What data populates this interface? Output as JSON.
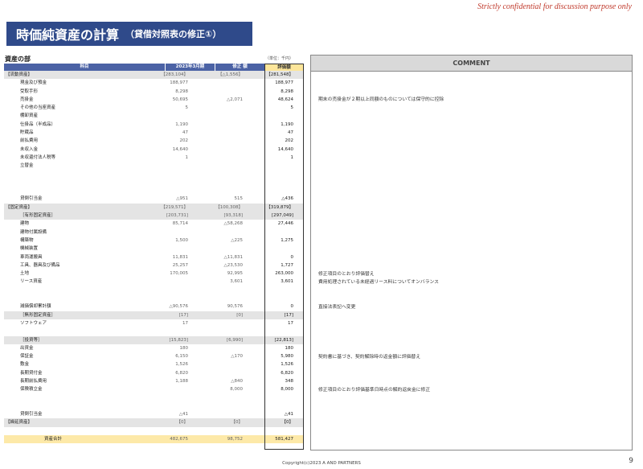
{
  "confidential": "Strictly confidential for discussion purpose only",
  "title": "時価純資産の計算",
  "subtitle": "（貸借対照表の修正①）",
  "section": "資産の部",
  "unit": "（単位：千円）",
  "headers": {
    "item": "科目",
    "col1": "2023年3月期",
    "col2": "修正 額",
    "col3": "評価額"
  },
  "rows": [
    {
      "label": "【流動資産】",
      "indent": 0,
      "shade": true,
      "v1": "【283,104】",
      "v2": "【△1,556】",
      "v3": "【281,548】"
    },
    {
      "label": "現金及び預金",
      "indent": 1,
      "v1": "188,977",
      "v2": "",
      "v3": "188,977"
    },
    {
      "label": "受取手形",
      "indent": 1,
      "v1": "8,298",
      "v2": "",
      "v3": "8,298"
    },
    {
      "label": "売掛金",
      "indent": 1,
      "v1": "50,695",
      "v2": "△2,071",
      "v3": "48,624"
    },
    {
      "label": "その他の当座資産",
      "indent": 1,
      "v1": "5",
      "v2": "",
      "v3": "5"
    },
    {
      "label": "棚卸資産",
      "indent": 1,
      "v1": "",
      "v2": "",
      "v3": ""
    },
    {
      "label": "仕掛品（半成品）",
      "indent": 1,
      "v1": "1,190",
      "v2": "",
      "v3": "1,190"
    },
    {
      "label": "貯蔵品",
      "indent": 1,
      "v1": "47",
      "v2": "",
      "v3": "47"
    },
    {
      "label": "前払費用",
      "indent": 1,
      "v1": "202",
      "v2": "",
      "v3": "202"
    },
    {
      "label": "未収入金",
      "indent": 1,
      "v1": "14,640",
      "v2": "",
      "v3": "14,640"
    },
    {
      "label": "未収還付法人税等",
      "indent": 1,
      "v1": "1",
      "v2": "",
      "v3": "1"
    },
    {
      "label": "立替金",
      "indent": 1,
      "v1": "",
      "v2": "",
      "v3": ""
    },
    {
      "label": "",
      "indent": 1,
      "v1": "",
      "v2": "",
      "v3": ""
    },
    {
      "label": "",
      "indent": 1,
      "v1": "",
      "v2": "",
      "v3": ""
    },
    {
      "label": "",
      "indent": 1,
      "v1": "",
      "v2": "",
      "v3": ""
    },
    {
      "label": "貸倒引当金",
      "indent": 1,
      "v1": "△951",
      "v2": "515",
      "v3": "△436"
    },
    {
      "label": "【固定資産】",
      "indent": 0,
      "shade": true,
      "v1": "【219,571】",
      "v2": "【100,308】",
      "v3": "【319,879】"
    },
    {
      "label": "［有形固定資産］",
      "indent": 1,
      "shade": true,
      "v1": "[203,731]",
      "v2": "[93,318]",
      "v3": "[297,049]"
    },
    {
      "label": "建物",
      "indent": 1,
      "v1": "85,714",
      "v2": "△58,268",
      "v3": "27,446"
    },
    {
      "label": "建物付属設備",
      "indent": 1,
      "v1": "",
      "v2": "",
      "v3": ""
    },
    {
      "label": "構築物",
      "indent": 1,
      "v1": "1,500",
      "v2": "△225",
      "v3": "1,275"
    },
    {
      "label": "機械装置",
      "indent": 1,
      "v1": "",
      "v2": "",
      "v3": ""
    },
    {
      "label": "車両運搬具",
      "indent": 1,
      "v1": "11,831",
      "v2": "△11,831",
      "v3": "0"
    },
    {
      "label": "工具、器具及び備品",
      "indent": 1,
      "v1": "25,257",
      "v2": "△23,530",
      "v3": "1,727"
    },
    {
      "label": "土地",
      "indent": 1,
      "v1": "170,005",
      "v2": "92,995",
      "v3": "263,000"
    },
    {
      "label": "リース資産",
      "indent": 1,
      "v1": "",
      "v2": "3,601",
      "v3": "3,601"
    },
    {
      "label": "",
      "indent": 1,
      "v1": "",
      "v2": "",
      "v3": ""
    },
    {
      "label": "",
      "indent": 1,
      "v1": "",
      "v2": "",
      "v3": ""
    },
    {
      "label": "減価償却累計額",
      "indent": 1,
      "v1": "△90,576",
      "v2": "90,576",
      "v3": "0"
    },
    {
      "label": "［無形固定資産］",
      "indent": 1,
      "shade": true,
      "v1": "[17]",
      "v2": "[0]",
      "v3": "[17]"
    },
    {
      "label": "ソフトウェア",
      "indent": 1,
      "v1": "17",
      "v2": "",
      "v3": "17"
    },
    {
      "label": "",
      "indent": 1,
      "v1": "",
      "v2": "",
      "v3": ""
    },
    {
      "label": "［投資等］",
      "indent": 1,
      "shade": true,
      "v1": "[15,823]",
      "v2": "[6,990]",
      "v3": "[22,813]"
    },
    {
      "label": "出資金",
      "indent": 1,
      "v1": "180",
      "v2": "",
      "v3": "180"
    },
    {
      "label": "保証金",
      "indent": 1,
      "v1": "6,150",
      "v2": "△170",
      "v3": "5,980"
    },
    {
      "label": "敷金",
      "indent": 1,
      "v1": "1,526",
      "v2": "",
      "v3": "1,526"
    },
    {
      "label": "長期貸付金",
      "indent": 1,
      "v1": "6,820",
      "v2": "",
      "v3": "6,820"
    },
    {
      "label": "長期前払費用",
      "indent": 1,
      "v1": "1,188",
      "v2": "△840",
      "v3": "348"
    },
    {
      "label": "保険積立金",
      "indent": 1,
      "v1": "",
      "v2": "8,000",
      "v3": "8,000"
    },
    {
      "label": "",
      "indent": 1,
      "v1": "",
      "v2": "",
      "v3": ""
    },
    {
      "label": "",
      "indent": 1,
      "v1": "",
      "v2": "",
      "v3": ""
    },
    {
      "label": "貸倒引当金",
      "indent": 1,
      "v1": "△41",
      "v2": "",
      "v3": "△41"
    },
    {
      "label": "【繰延資産】",
      "indent": 0,
      "shade": true,
      "v1": "【0】",
      "v2": "【0】",
      "v3": "【0】"
    },
    {
      "label": "",
      "indent": 1,
      "v1": "",
      "v2": "",
      "v3": ""
    },
    {
      "label": "資産合計",
      "indent": 2,
      "total": true,
      "v1": "482,675",
      "v2": "98,752",
      "v3": "581,427"
    }
  ],
  "comment_header": "COMMENT",
  "comments": [
    {
      "row": 3,
      "text": "期末の売掛金が２期以上同額のものについては保守的に控除"
    },
    {
      "row": 24,
      "text": "修正項目のとおり評価替え"
    },
    {
      "row": 25,
      "text": "費用処理されている未経過リース料についてオンバランス"
    },
    {
      "row": 28,
      "text": "直接法表記へ変更"
    },
    {
      "row": 34,
      "text": "契約書に基づき、契約解除時の返金額に評価替え"
    },
    {
      "row": 38,
      "text": "修正項目のとおり評価基準日時点の解約返戻金に修正"
    }
  ],
  "footer": "Copyright(c)2023  A AND PARTNERS",
  "page": "9"
}
